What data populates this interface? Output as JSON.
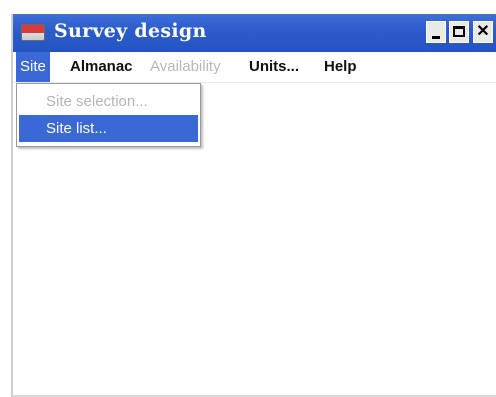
{
  "window": {
    "title": "Survey design",
    "icon": "app-icon",
    "controls": {
      "minimize": "minimize-icon",
      "maximize": "maximize-icon",
      "close": "close-icon",
      "close_glyph": "✕"
    }
  },
  "menubar": {
    "items": [
      {
        "label": "Site",
        "state": "open"
      },
      {
        "label": "Almanac",
        "state": "enabled"
      },
      {
        "label": "Availability",
        "state": "disabled"
      },
      {
        "label": "Units...",
        "state": "enabled"
      },
      {
        "label": "Help",
        "state": "enabled"
      }
    ]
  },
  "site_menu": {
    "items": [
      {
        "label": "Site selection...",
        "state": "disabled"
      },
      {
        "label": "Site list...",
        "state": "highlighted"
      }
    ]
  },
  "colors": {
    "titlebar": "#2d5ccc",
    "menu_highlight": "#3a68d4",
    "disabled_text": "#b9b9b9"
  }
}
